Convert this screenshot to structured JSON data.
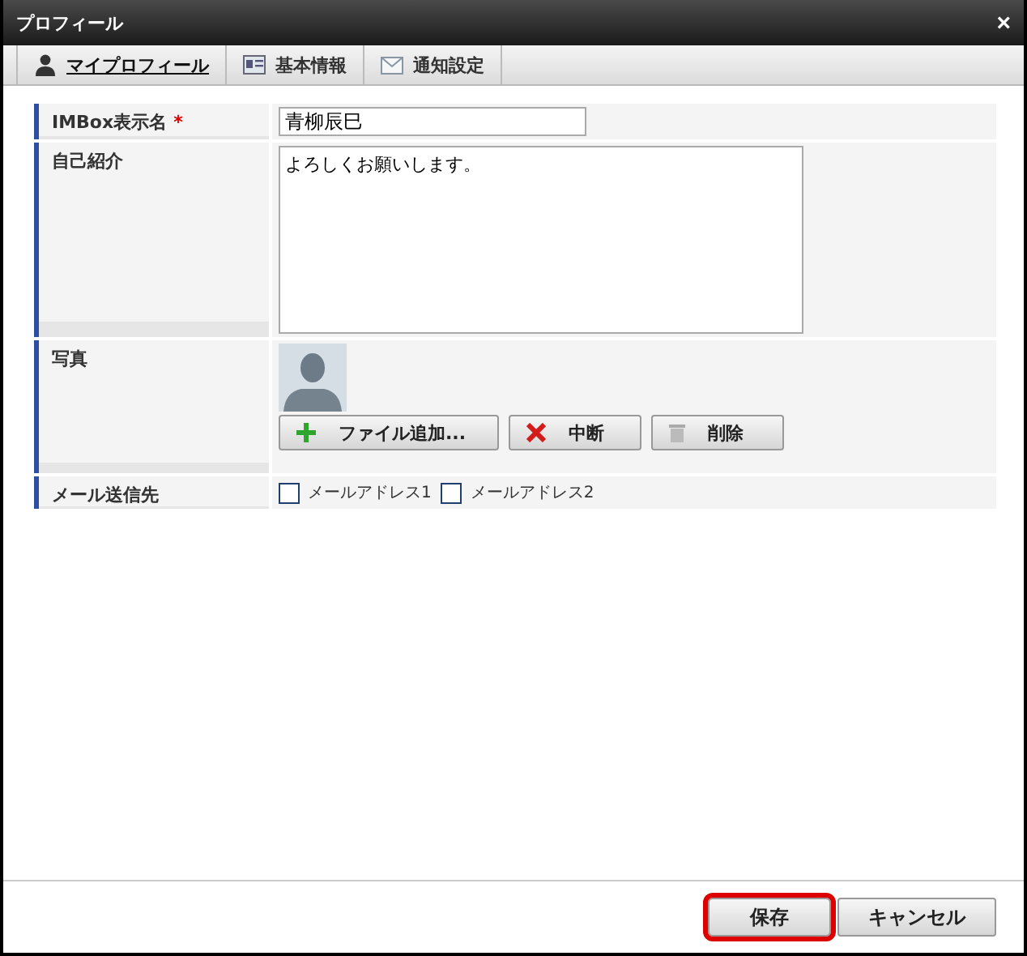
{
  "window": {
    "title": "プロフィール",
    "close": "×"
  },
  "tabs": [
    {
      "label": "マイプロフィール",
      "selected": true
    },
    {
      "label": "基本情報",
      "selected": false
    },
    {
      "label": "通知設定",
      "selected": false
    }
  ],
  "form": {
    "rows": [
      {
        "kind": "text",
        "label": "IMBox表示名",
        "required_mark": "*",
        "value": "青柳辰巳"
      },
      {
        "kind": "textarea",
        "label": "自己紹介",
        "value": "よろしくお願いします。"
      },
      {
        "kind": "photo",
        "label": "写真",
        "buttons": [
          {
            "label": "ファイル追加..."
          },
          {
            "label": "中断"
          },
          {
            "label": "削除"
          }
        ]
      },
      {
        "kind": "checks",
        "label": "メール送信先",
        "options": [
          {
            "label": "メールアドレス1",
            "checked": false
          },
          {
            "label": "メールアドレス2",
            "checked": false
          }
        ]
      }
    ]
  },
  "footer": {
    "buttons": [
      {
        "label": "保存",
        "focused": true
      },
      {
        "label": "キャンセル",
        "focused": false
      }
    ]
  }
}
